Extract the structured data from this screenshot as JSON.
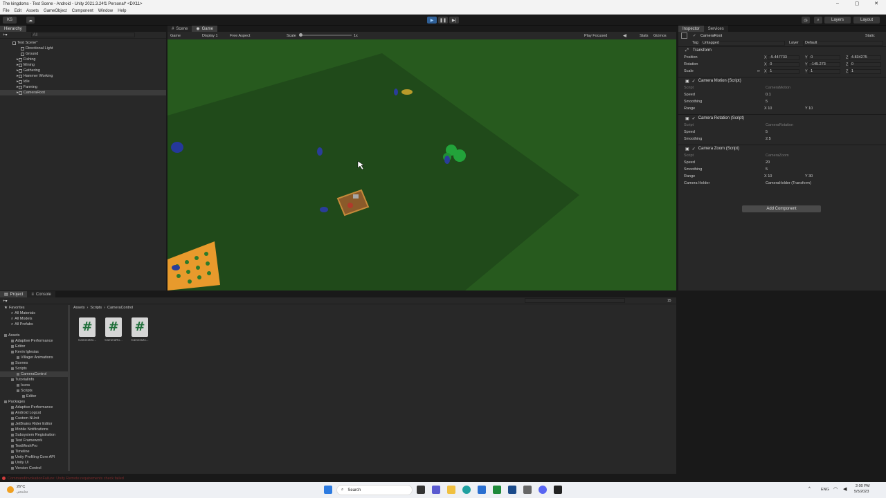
{
  "window": {
    "title": "The kingdoms - Test Scene - Android - Unity 2021.3.24f1 Personal* <DX11>"
  },
  "menu": [
    "File",
    "Edit",
    "Assets",
    "GameObject",
    "Component",
    "Window",
    "Help"
  ],
  "toolbar": {
    "account": "KS",
    "layers": "Layers",
    "layout": "Layout"
  },
  "hierarchy": {
    "tab": "Hierarchy",
    "search_placeholder": "All",
    "scene": "Test Scene*",
    "items": [
      "Directional Light",
      "Ground",
      "Fishing",
      "Mining",
      "Gathering",
      "Hammer Working",
      "Idle",
      "Farming",
      "CameraRoot"
    ]
  },
  "view_tabs": {
    "scene": "Scene",
    "game": "Game"
  },
  "game_bar": {
    "mode": "Game",
    "display": "Display 1",
    "aspect": "Free Aspect",
    "scale_label": "Scale",
    "scale_value": "1x",
    "play": "Play Focused",
    "stats": "Stats",
    "gizmos": "Gizmos"
  },
  "inspector": {
    "tabs": [
      "Inspector",
      "Services"
    ],
    "object_name": "CameraRoot",
    "static": "Static",
    "tag_label": "Tag",
    "tag": "Untagged",
    "layer_label": "Layer",
    "layer": "Default",
    "transform": {
      "title": "Transform",
      "position": {
        "label": "Position",
        "x": "-5.447733",
        "y": "0",
        "z": "4.834275"
      },
      "rotation": {
        "label": "Rotation",
        "x": "0",
        "y": "-145.273",
        "z": "0"
      },
      "scale": {
        "label": "Scale",
        "x": "1",
        "y": "1",
        "z": "1"
      }
    },
    "motion": {
      "title": "Camera Motion (Script)",
      "script_label": "Script",
      "script": "CameraMotion",
      "speed_label": "Speed",
      "speed": "0.1",
      "smoothing_label": "Smoothing",
      "smoothing": "5",
      "range_label": "Range",
      "range_x": "10",
      "range_y": "10"
    },
    "rotation_script": {
      "title": "Camera Rotation (Script)",
      "script_label": "Script",
      "script": "CameraRotation",
      "speed_label": "Speed",
      "speed": "5",
      "smoothing_label": "Smoothing",
      "smoothing": "2.5"
    },
    "zoom": {
      "title": "Camera Zoom (Script)",
      "script_label": "Script",
      "script": "CameraZoom",
      "speed_label": "Speed",
      "speed": "20",
      "smoothing_label": "Smoothing",
      "smoothing": "5",
      "range_label": "Range",
      "range_x": "10",
      "range_y": "30",
      "holder_label": "Camera Holder",
      "holder": "CameraHolder (Transform)"
    },
    "add_component": "Add Component"
  },
  "project": {
    "tabs": [
      "Project",
      "Console"
    ],
    "breadcrumb": [
      "Assets",
      "Scripts",
      "CameraControl"
    ],
    "favorites_title": "Favorites",
    "favorites": [
      "All Materials",
      "All Models",
      "All Prefabs"
    ],
    "assets_title": "Assets",
    "assets": [
      "Adaptive Performance",
      "Editor",
      "Kevin Iglesias",
      "Villager Animations",
      "Scenes",
      "Scripts",
      "CameraControl",
      "TutorialInfo",
      "Icons",
      "Scripts",
      "Editor"
    ],
    "packages_title": "Packages",
    "packages": [
      "Adaptive Performance",
      "Android Logcat",
      "Custom NUnit",
      "JetBrains Rider Editor",
      "Mobile Notifications",
      "Subsystem Registration",
      "Test Framework",
      "TextMeshPro",
      "Timeline",
      "Unity Profiling Core API",
      "Unity UI",
      "Version Control"
    ],
    "files": [
      "CameraMo...",
      "CameraRo...",
      "CameraZo..."
    ],
    "count": "15"
  },
  "status": {
    "error": "CommandInvokationFailure: Unity Remote requirements check failed"
  },
  "taskbar": {
    "temp": "26°C",
    "weather": "مشمس",
    "search": "Search",
    "lang": "ENG",
    "time": "2:00 PM",
    "date": "5/5/2023"
  },
  "colors": {
    "ground": "#275a1e",
    "plane": "#204a1a",
    "farm": "#e89a2c",
    "accent": "#4d8df5",
    "error": "#d23c3c"
  }
}
